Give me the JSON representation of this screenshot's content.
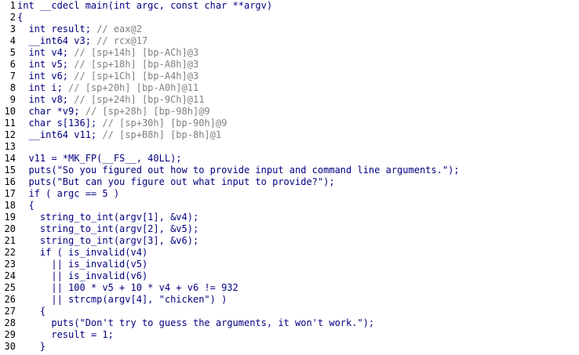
{
  "viewer": {
    "lines": [
      {
        "n": "1",
        "text": "int __cdecl main(int argc, const char **argv)"
      },
      {
        "n": "2",
        "text": "{"
      },
      {
        "n": "3",
        "text": "  int result; // eax@2"
      },
      {
        "n": "4",
        "text": "  __int64 v3; // rcx@17"
      },
      {
        "n": "5",
        "text": "  int v4; // [sp+14h] [bp-ACh]@3"
      },
      {
        "n": "6",
        "text": "  int v5; // [sp+18h] [bp-A8h]@3"
      },
      {
        "n": "7",
        "text": "  int v6; // [sp+1Ch] [bp-A4h]@3"
      },
      {
        "n": "8",
        "text": "  int i; // [sp+20h] [bp-A0h]@11"
      },
      {
        "n": "9",
        "text": "  int v8; // [sp+24h] [bp-9Ch]@11"
      },
      {
        "n": "10",
        "text": "  char *v9; // [sp+28h] [bp-98h]@9"
      },
      {
        "n": "11",
        "text": "  char s[136]; // [sp+30h] [bp-90h]@9"
      },
      {
        "n": "12",
        "text": "  __int64 v11; // [sp+B8h] [bp-8h]@1"
      },
      {
        "n": "13",
        "text": ""
      },
      {
        "n": "14",
        "text": "  v11 = *MK_FP(__FS__, 40LL);"
      },
      {
        "n": "15",
        "text": "  puts(\"So you figured out how to provide input and command line arguments.\");"
      },
      {
        "n": "16",
        "text": "  puts(\"But can you figure out what input to provide?\");"
      },
      {
        "n": "17",
        "text": "  if ( argc == 5 )"
      },
      {
        "n": "18",
        "text": "  {"
      },
      {
        "n": "19",
        "text": "    string_to_int(argv[1], &v4);"
      },
      {
        "n": "20",
        "text": "    string_to_int(argv[2], &v5);"
      },
      {
        "n": "21",
        "text": "    string_to_int(argv[3], &v6);"
      },
      {
        "n": "22",
        "text": "    if ( is_invalid(v4)"
      },
      {
        "n": "23",
        "text": "      || is_invalid(v5)"
      },
      {
        "n": "24",
        "text": "      || is_invalid(v6)"
      },
      {
        "n": "25",
        "text": "      || 100 * v5 + 10 * v4 + v6 != 932"
      },
      {
        "n": "26",
        "text": "      || strcmp(argv[4], \"chicken\") )"
      },
      {
        "n": "27",
        "text": "    {"
      },
      {
        "n": "28",
        "text": "      puts(\"Don't try to guess the arguments, it won't work.\");"
      },
      {
        "n": "29",
        "text": "      result = 1;"
      },
      {
        "n": "30",
        "text": "    }"
      }
    ],
    "colors": {
      "background": "#ffffff",
      "line_number": "#000000",
      "code": "#000080",
      "comment": "#808080",
      "highlight": "#ffff00"
    }
  }
}
